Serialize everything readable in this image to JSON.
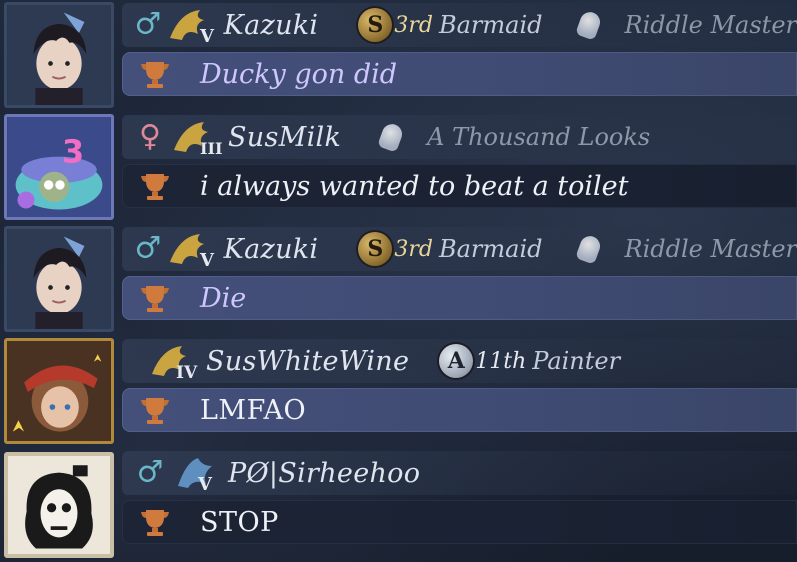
{
  "colors": {
    "male": "#69b7c9",
    "female": "#e0889a",
    "self_bubble": "#44507a",
    "other_bubble": "#1c2435",
    "self_text": "#cfc6ff",
    "gold": "#d9b96a"
  },
  "messages": [
    {
      "avatar": "male-character-portrait",
      "gender_icon": "male-icon",
      "gender_symbol": "♂",
      "rank_icon": "rank-v-icon",
      "name": "Kazuki",
      "badge": {
        "medal": "S",
        "place": "3rd",
        "title": "Barmaid"
      },
      "title2": "Riddle Master",
      "cup_icon": "trophy-icon",
      "text": "Ducky gon did"
    },
    {
      "avatar": "birthday-cake-portrait",
      "gender_icon": "female-icon",
      "gender_symbol": "♀",
      "rank_icon": "rank-iii-icon",
      "name": "SusMilk",
      "title2": "A Thousand Looks",
      "cup_icon": "trophy-icon",
      "text": "i always wanted to beat a toilet"
    },
    {
      "avatar": "male-character-portrait",
      "gender_icon": "male-icon",
      "gender_symbol": "♂",
      "rank_icon": "rank-v-icon",
      "name": "Kazuki",
      "badge": {
        "medal": "S",
        "place": "3rd",
        "title": "Barmaid"
      },
      "title2": "Riddle Master",
      "cup_icon": "trophy-icon",
      "text": "Die"
    },
    {
      "avatar": "red-hat-portrait",
      "rank_icon": "rank-iv-icon",
      "name": "SusWhiteWine",
      "badge": {
        "medal": "A",
        "place": "11th",
        "title": "Painter"
      },
      "cup_icon": "trophy-icon",
      "text": "LMFAO"
    },
    {
      "avatar": "pale-figure-portrait",
      "gender_icon": "male-icon",
      "gender_symbol": "♂",
      "rank_icon": "rank-v-icon",
      "name": "PØ|Sirheehoo",
      "cup_icon": "trophy-icon",
      "text": "STOP"
    }
  ]
}
